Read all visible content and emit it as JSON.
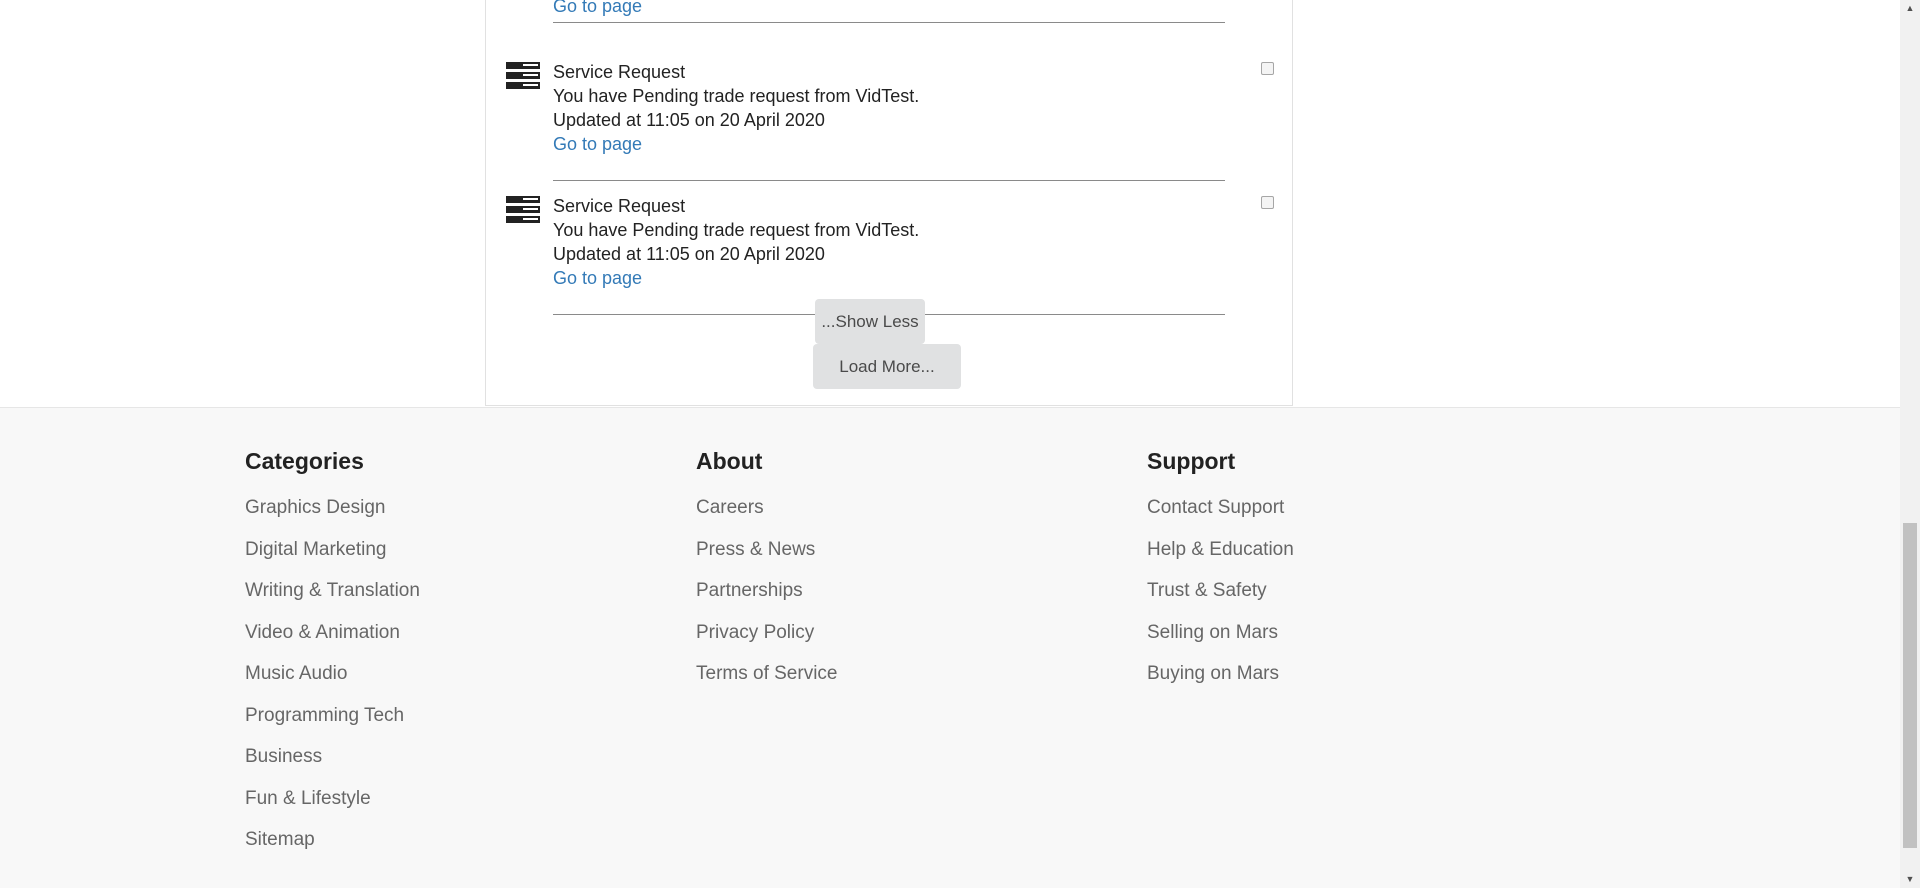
{
  "notifications": {
    "partial_link": "Go to page",
    "items": [
      {
        "title": "Service Request",
        "message": "You have Pending trade request from VidTest.",
        "updated": "Updated at 11:05 on 20 April 2020",
        "link": "Go to page",
        "icon": "server-icon"
      },
      {
        "title": "Service Request",
        "message": "You have Pending trade request from VidTest.",
        "updated": "Updated at 11:05 on 20 April 2020",
        "link": "Go to page",
        "icon": "server-icon"
      }
    ],
    "show_less_label": "...Show Less",
    "load_more_label": "Load More..."
  },
  "footer": {
    "categories": {
      "heading": "Categories",
      "items": [
        "Graphics Design",
        "Digital Marketing",
        "Writing & Translation",
        "Video & Animation",
        "Music Audio",
        "Programming Tech",
        "Business",
        "Fun & Lifestyle",
        "Sitemap"
      ]
    },
    "about": {
      "heading": "About",
      "items": [
        "Careers",
        "Press & News",
        "Partnerships",
        "Privacy Policy",
        "Terms of Service"
      ]
    },
    "support": {
      "heading": "Support",
      "items": [
        "Contact Support",
        "Help & Education",
        "Trust & Safety",
        "Selling on Mars",
        "Buying on Mars"
      ]
    }
  },
  "colors": {
    "link": "#337ab7",
    "footer_bg": "#f8f8f8",
    "button_bg": "#e0e1e2"
  }
}
